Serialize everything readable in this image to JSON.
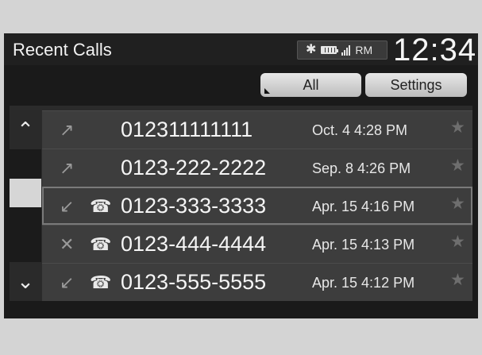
{
  "header": {
    "title": "Recent Calls",
    "time": "12:34",
    "status": {
      "bluetooth_icon": "bluetooth-icon",
      "battery_icon": "battery-icon",
      "signal_icon": "signal-icon",
      "roaming_label": "RM"
    }
  },
  "toolbar": {
    "all_label": "All",
    "settings_label": "Settings"
  },
  "list": {
    "rows": [
      {
        "number": "012311111111",
        "timestamp": "Oct. 4 4:28 PM",
        "call_icon": "outgoing-call-icon",
        "phone_icon": "",
        "star_icon": "star-icon"
      },
      {
        "number": "0123-222-2222",
        "timestamp": "Sep. 8 4:26 PM",
        "call_icon": "outgoing-call-icon",
        "phone_icon": "",
        "star_icon": "star-icon"
      },
      {
        "number": "0123-333-3333",
        "timestamp": "Apr. 15 4:16 PM",
        "call_icon": "incoming-call-icon",
        "phone_icon": "phone-icon",
        "star_icon": "star-icon"
      },
      {
        "number": "0123-444-4444",
        "timestamp": "Apr. 15 4:13 PM",
        "call_icon": "missed-call-icon",
        "phone_icon": "phone-icon",
        "star_icon": "star-icon"
      },
      {
        "number": "0123-555-5555",
        "timestamp": "Apr. 15 4:12 PM",
        "call_icon": "incoming-call-icon",
        "phone_icon": "phone-icon",
        "star_icon": "star-icon"
      }
    ],
    "scroll": {
      "up_icon": "chevron-up-icon",
      "down_icon": "chevron-down-icon"
    }
  }
}
